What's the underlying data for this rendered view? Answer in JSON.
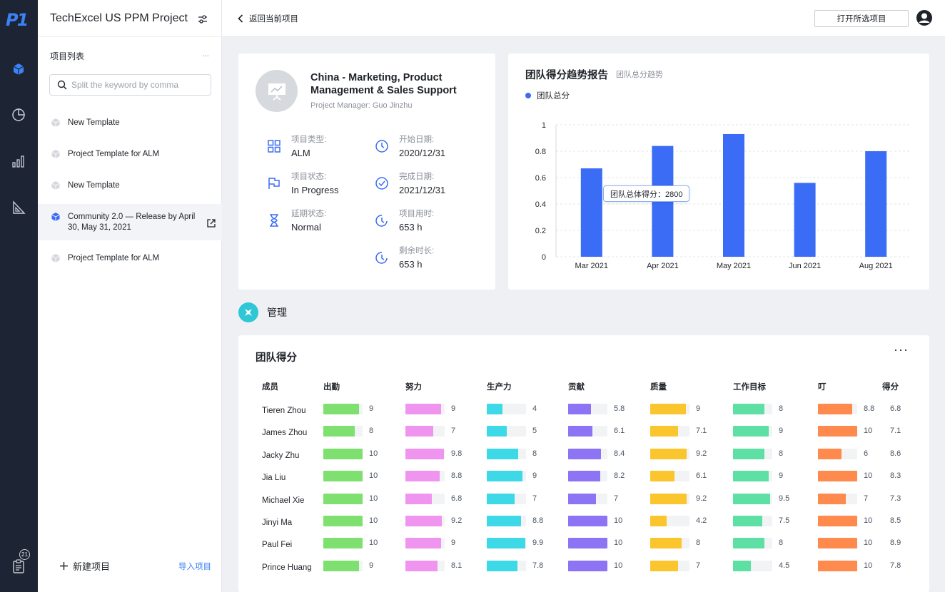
{
  "rail": {
    "logo": "P1",
    "badge_count": "21",
    "icons": [
      "cube-icon",
      "pie-chart-icon",
      "bar-chart-icon",
      "triangle-ruler-icon",
      "clipboard-icon"
    ]
  },
  "panel": {
    "title": "TechExcel US PPM Project",
    "list_header": "项目列表",
    "more": "...",
    "search_placeholder": "Split the keyword by comma",
    "projects": [
      {
        "label": "New Template"
      },
      {
        "label": "Project Template for ALM"
      },
      {
        "label": "New Template"
      },
      {
        "label": "Community 2.0 — Release by April 30, May 31, 2021"
      },
      {
        "label": "Project Template for ALM"
      }
    ],
    "new_project": "新建项目",
    "import_project": "导入项目"
  },
  "topbar": {
    "back_label": "返回当前项目",
    "open_button": "打开所选项目"
  },
  "project": {
    "name": "China - Marketing, Product Management & Sales Support",
    "manager": "Project Manager: Guo Jinzhu",
    "fields": [
      {
        "label": "项目类型:",
        "value": "ALM"
      },
      {
        "label": "开始日期:",
        "value": "2020/12/31"
      },
      {
        "label": "项目状态:",
        "value": "In Progress"
      },
      {
        "label": "完成日期:",
        "value": "2021/12/31"
      },
      {
        "label": "延期状态:",
        "value": "Normal"
      },
      {
        "label": "项目用时:",
        "value": "653 h"
      },
      {
        "label": "剩余时长:",
        "value": "653 h"
      }
    ]
  },
  "chart_data": {
    "type": "bar",
    "title": "团队得分趋势报告",
    "subtitle": "团队总分趋势",
    "categories": [
      "Mar 2021",
      "Apr 2021",
      "May 2021",
      "Jun 2021",
      "Aug 2021"
    ],
    "series": [
      {
        "name": "团队总分",
        "values": [
          0.67,
          0.84,
          0.93,
          0.56,
          0.8
        ],
        "color": "#3b6cf5"
      }
    ],
    "ylim": [
      0,
      1
    ],
    "yticks": [
      "0",
      "0.2",
      "0.4",
      "0.6",
      "0.8",
      "1"
    ],
    "grid": true,
    "legend": "top-left",
    "tooltip": "团队总体得分：2800"
  },
  "section": {
    "title": "管理"
  },
  "score_table": {
    "title": "团队得分",
    "more": "···",
    "headers": [
      "成员",
      "出勤",
      "努力",
      "生产力",
      "贡献",
      "质量",
      "工作目标",
      "叮",
      "得分"
    ],
    "colors": [
      "#7ee06f",
      "#ef95ef",
      "#3dd9e6",
      "#8c74f5",
      "#fbc52d",
      "#5ee0a4",
      "#ff8a4d"
    ],
    "rows": [
      {
        "name": "Tieren Zhou",
        "values": [
          "9",
          "9",
          "4",
          "5.8",
          "9",
          "8",
          "8.8"
        ],
        "score": "6.8"
      },
      {
        "name": "James Zhou",
        "values": [
          "8",
          "7",
          "5",
          "6.1",
          "7.1",
          "9",
          "10"
        ],
        "score": "7.1"
      },
      {
        "name": "Jacky Zhu",
        "values": [
          "10",
          "9.8",
          "8",
          "8.4",
          "9.2",
          "8",
          "6"
        ],
        "score": "8.6"
      },
      {
        "name": "Jia Liu",
        "values": [
          "10",
          "8.8",
          "9",
          "8.2",
          "6.1",
          "9",
          "10"
        ],
        "score": "8.3"
      },
      {
        "name": "Michael Xie",
        "values": [
          "10",
          "6.8",
          "7",
          "7",
          "9.2",
          "9.5",
          "7"
        ],
        "score": "7.3"
      },
      {
        "name": "Jinyi Ma",
        "values": [
          "10",
          "9.2",
          "8.8",
          "10",
          "4.2",
          "7.5",
          "10"
        ],
        "score": "8.5"
      },
      {
        "name": "Paul Fei",
        "values": [
          "10",
          "9",
          "9.9",
          "10",
          "8",
          "8",
          "10"
        ],
        "score": "8.9"
      },
      {
        "name": "Prince Huang",
        "values": [
          "9",
          "8.1",
          "7.8",
          "10",
          "7",
          "4.5",
          "10"
        ],
        "score": "7.8"
      }
    ]
  }
}
